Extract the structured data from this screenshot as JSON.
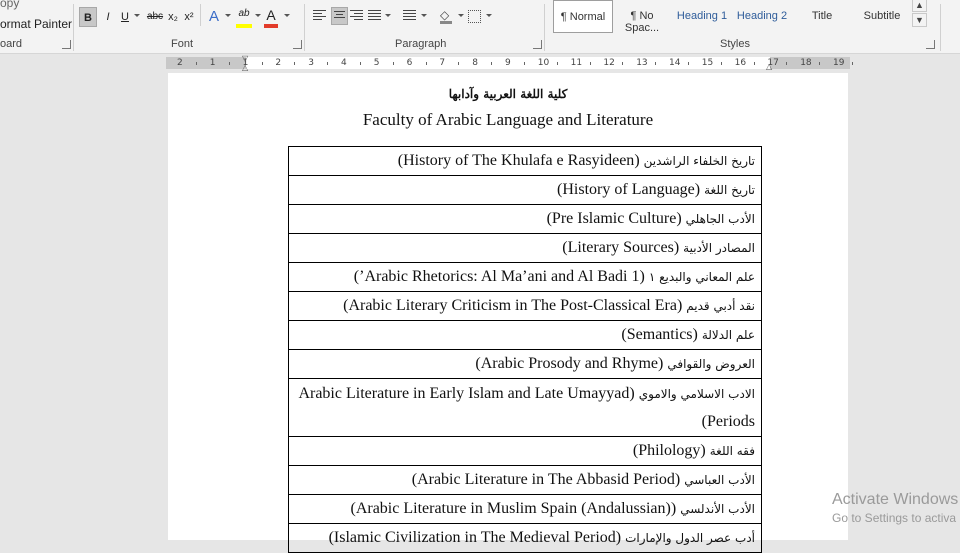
{
  "ribbon": {
    "clipboard": {
      "copy_label": "opy",
      "format_painter_label": "ormat Painter",
      "group_label": "oard"
    },
    "font": {
      "bold": "B",
      "italic": "I",
      "underline": "U",
      "strikethrough": "abc",
      "subscript": "x₂",
      "superscript": "x²",
      "text_effects": "A",
      "highlight": "ab",
      "font_color": "A",
      "group_label": "Font"
    },
    "paragraph": {
      "group_label": "Paragraph"
    },
    "styles": {
      "items": [
        {
          "label": "¶ Normal"
        },
        {
          "label": "¶ No Spac..."
        },
        {
          "label": "Heading 1"
        },
        {
          "label": "Heading 2"
        },
        {
          "label": "Title"
        },
        {
          "label": "Subtitle"
        }
      ],
      "group_label": "Styles"
    },
    "colors": {
      "highlight": "#ffff00",
      "font_color": "#e23b2a",
      "text_effects": "#3a6cc8"
    }
  },
  "ruler": {
    "ticks": [
      "2",
      "1",
      "1",
      "2",
      "3",
      "4",
      "5",
      "6",
      "7",
      "8",
      "9",
      "10",
      "11",
      "12",
      "13",
      "14",
      "15",
      "16",
      "17",
      "18",
      "19"
    ]
  },
  "document": {
    "arabic_heading": "كلية اللغة العربية وآدابها",
    "english_heading": "Faculty of Arabic Language and Literature",
    "courses": [
      {
        "ar": "تاريخ الخلفاء الراشدين",
        "en": "(History of The Khulafa e Rasyideen)"
      },
      {
        "ar": "تاريخ اللغة",
        "en": "(History of Language)"
      },
      {
        "ar": "الأدب الجاهلي",
        "en": "(Pre Islamic Culture)"
      },
      {
        "ar": "المصادر الأدبية",
        "en": "(Literary Sources)"
      },
      {
        "ar": "علم المعاني والبديع ١",
        "en": "(Arabic Rhetorics: Al Ma’ani and Al Badi 1’)"
      },
      {
        "ar": "نقد أدبي قديم",
        "en": "(Arabic Literary Criticism in The Post-Classical Era)"
      },
      {
        "ar": "علم الدلالة",
        "en": "(Semantics)"
      },
      {
        "ar": "العروض والقوافي",
        "en": "(Arabic Prosody and Rhyme)"
      },
      {
        "ar": "الادب الاسلامي والاموي",
        "en": "(Arabic Literature in Early Islam and Late Umayyad Periods)"
      },
      {
        "ar": "فقه اللغة",
        "en": "(Philology)"
      },
      {
        "ar": "الأدب العباسي",
        "en": "(Arabic Literature in The Abbasid Period)"
      },
      {
        "ar": "الأدب الأندلسي",
        "en": "(Arabic Literature in Muslim Spain (Andalussian))"
      },
      {
        "ar": "أدب عصر الدول والإمارات",
        "en": "(Islamic Civilization in The Medieval Period)"
      }
    ]
  },
  "watermark": {
    "line1": "Activate Windows",
    "line2": "Go to Settings to activa"
  }
}
